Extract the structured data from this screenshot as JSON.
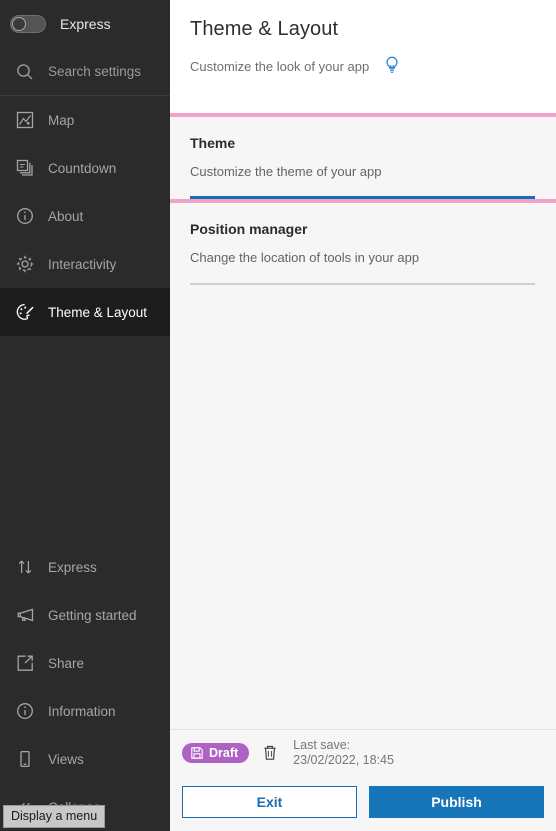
{
  "sidebar": {
    "express_toggle": {
      "label": "Express",
      "state": "off"
    },
    "search": {
      "placeholder": "Search settings",
      "icon": "search-icon"
    },
    "top_items": [
      {
        "label": "Map",
        "icon": "map-icon",
        "active": false
      },
      {
        "label": "Countdown",
        "icon": "layers-icon",
        "active": false
      },
      {
        "label": "About",
        "icon": "info-circle-icon",
        "active": false
      },
      {
        "label": "Interactivity",
        "icon": "gear-icon",
        "active": false
      },
      {
        "label": "Theme & Layout",
        "icon": "palette-icon",
        "active": true
      }
    ],
    "bottom_items": [
      {
        "label": "Express",
        "icon": "arrows-up-down-icon"
      },
      {
        "label": "Getting started",
        "icon": "megaphone-icon"
      },
      {
        "label": "Share",
        "icon": "share-export-icon"
      },
      {
        "label": "Information",
        "icon": "info-circle-icon"
      },
      {
        "label": "Views",
        "icon": "mobile-device-icon"
      },
      {
        "label": "Collapse",
        "icon": "double-chevron-left-icon"
      }
    ],
    "tooltip": "Display a menu"
  },
  "header": {
    "title": "Theme & Layout",
    "subtitle": "Customize the look of your app",
    "hint_icon": "lightbulb-icon"
  },
  "sections": [
    {
      "title": "Theme",
      "description": "Customize the theme of your app",
      "rule": "blue"
    },
    {
      "title": "Position manager",
      "description": "Change the location of tools in your app",
      "rule": "gray"
    }
  ],
  "footer": {
    "status_badge": {
      "label": "Draft",
      "icon": "save-floppy-icon",
      "color": "#af62c3"
    },
    "delete_icon": "trash-icon",
    "last_save_label": "Last save:",
    "last_save_value": "23/02/2022, 18:45",
    "exit_button": "Exit",
    "publish_button": "Publish"
  },
  "colors": {
    "accent_blue": "#1775ba",
    "pink_rule": "#f0a3c6",
    "sidebar_bg": "#2b2b2b",
    "panel_bg": "#f6f6f6"
  }
}
